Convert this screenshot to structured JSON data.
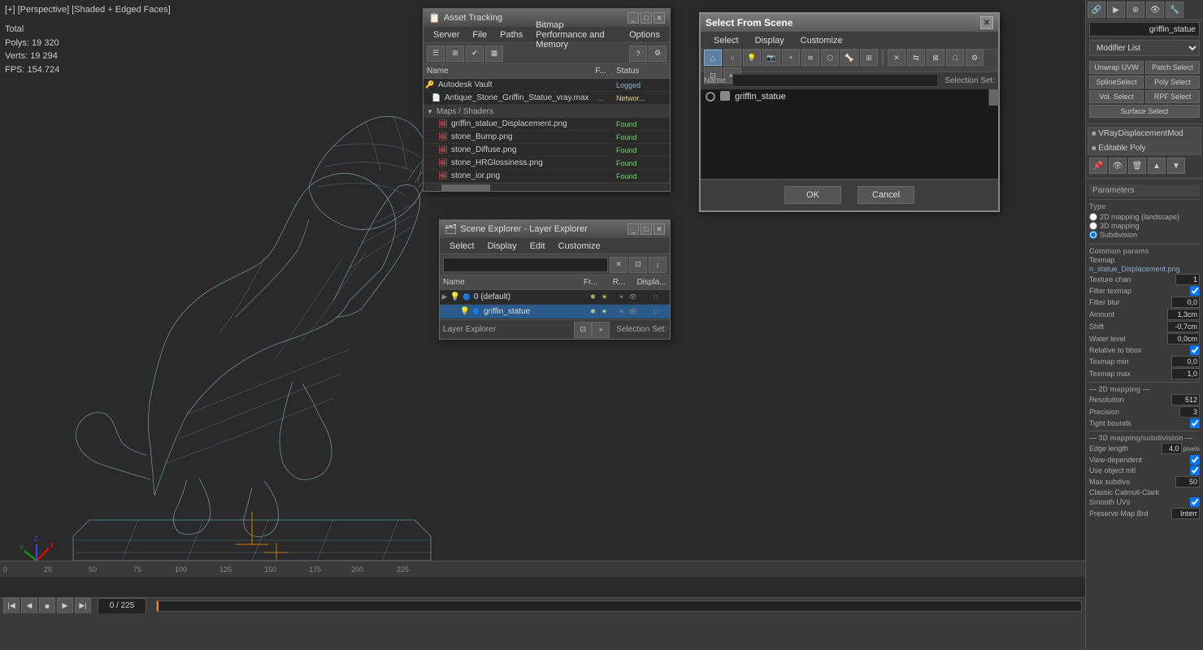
{
  "viewport": {
    "label": "[+] [Perspective] [Shaded + Edged Faces]",
    "stats": {
      "polys_label": "Polys:",
      "polys_value": "19 320",
      "verts_label": "Verts:",
      "verts_value": "19 294",
      "fps_label": "FPS:",
      "fps_value": "154.724",
      "total_label": "Total"
    }
  },
  "asset_window": {
    "title": "Asset Tracking",
    "menu": [
      "Server",
      "File",
      "Paths",
      "Bitmap Performance and Memory",
      "Options"
    ],
    "columns": [
      "Name",
      "F...",
      "Status"
    ],
    "items": [
      {
        "name": "Autodesk Vault",
        "type": "vault",
        "f": "",
        "status": "Logged",
        "status_type": "logged",
        "indent": 0
      },
      {
        "name": "Antique_Stone_Griffin_Statue_vray.max",
        "type": "file",
        "f": "...",
        "status": "Networ...",
        "status_type": "network",
        "indent": 1
      },
      {
        "name": "Maps / Shaders",
        "type": "group",
        "indent": 2
      },
      {
        "name": "griffin_statue_Displacement.png",
        "type": "image",
        "f": "",
        "status": "Found",
        "status_type": "found",
        "indent": 3
      },
      {
        "name": "stone_Bump.png",
        "type": "image",
        "f": "",
        "status": "Found",
        "status_type": "found",
        "indent": 3
      },
      {
        "name": "stone_Diffuse.png",
        "type": "image",
        "f": "",
        "status": "Found",
        "status_type": "found",
        "indent": 3
      },
      {
        "name": "stone_HRGlossiness.png",
        "type": "image",
        "f": "",
        "status": "Found",
        "status_type": "found",
        "indent": 3
      },
      {
        "name": "stone_ior.png",
        "type": "image",
        "f": "",
        "status": "Found",
        "status_type": "found",
        "indent": 3
      }
    ]
  },
  "scene_window": {
    "title": "Scene Explorer - Layer Explorer",
    "menu": [
      "Select",
      "Display",
      "Edit",
      "Customize"
    ],
    "columns": [
      "Name",
      "Fr...",
      "R...",
      "Displa..."
    ],
    "rows": [
      {
        "name": "0 (default)",
        "type": "layer",
        "selected": false,
        "indent": 0
      },
      {
        "name": "griffin_statue",
        "type": "object",
        "selected": true,
        "indent": 1
      }
    ],
    "bottom": {
      "layer_explorer": "Layer Explorer",
      "selection_set": "Selection Set:"
    }
  },
  "select_window": {
    "title": "Select From Scene",
    "menu": [
      "Select",
      "Display",
      "Customize"
    ],
    "name_label": "Name",
    "items": [
      {
        "name": "griffin_statue",
        "type": "object"
      }
    ],
    "ok_label": "OK",
    "cancel_label": "Cancel",
    "selection_set_label": "Selection Set:"
  },
  "right_panel": {
    "object_name": "griffin_statue",
    "modifier_list_label": "Modifier List",
    "buttons": {
      "unwrap_uvw": "Unwrap UVW",
      "patch_select": "Patch Select",
      "spline_select": "SplineSelect",
      "poly_select": "Poly Select",
      "vol_select": "Vol. Select",
      "rpf_select": "RPF Select",
      "surface_select": "Surface Select"
    },
    "modifiers": [
      {
        "name": "VRayDisplacementMod",
        "selected": false
      },
      {
        "name": "Editable Poly",
        "selected": false
      }
    ],
    "params": {
      "section_title": "Parameters",
      "type_label": "Type",
      "type_2d": "2D mapping (landscape)",
      "type_3d": "3D mapping",
      "type_subdiv": "Subdivision",
      "common_params": "Common params",
      "texmap_label": "Texmap",
      "texmap_value": "n_statue_Displacement.png",
      "texture_chan_label": "Texture chan",
      "texture_chan_value": "1",
      "filter_texmap_label": "Filter texmap",
      "filter_texmap_checked": true,
      "filter_blur_label": "Filter blur",
      "filter_blur_value": "0,0",
      "amount_label": "Amount",
      "amount_value": "1,3cm",
      "shift_label": "Shift",
      "shift_value": "-0,7cm",
      "water_level_label": "Water level",
      "water_level_value": "0,0cm",
      "relative_bbox_label": "Relative to bbox",
      "relative_bbox_checked": true,
      "texmap_min_label": "Texmap min",
      "texmap_min_value": "0,0",
      "texmap_max_label": "Texmap max",
      "texmap_max_value": "1,0",
      "mapping_2d_label": "2D mapping",
      "resolution_label": "Resolution",
      "resolution_value": "512",
      "precision_label": "Precision",
      "precision_value": "3",
      "tight_bounds_label": "Tight bounds",
      "tight_bounds_checked": true,
      "mapping_3d_label": "3D mapping/subdivision",
      "edge_length_label": "Edge length",
      "edge_length_value": "4,0",
      "edge_length_unit": "pixels",
      "view_dependent_label": "View-dependent",
      "view_dependent_checked": true,
      "use_object_mtl_label": "Use object mtl",
      "use_object_mtl_checked": true,
      "max_subdivs_label": "Max subdivs",
      "max_subdivs_value": "50",
      "classic_label": "Classic Catmull-Clark",
      "smooth_uvs_label": "Smooth UVs",
      "smooth_uvs_checked": true,
      "preserve_map_borders_label": "Preserve Map Brd",
      "preserve_map_borders_value": "Interr"
    }
  },
  "bottom_bar": {
    "frame_display": "0 / 225"
  }
}
